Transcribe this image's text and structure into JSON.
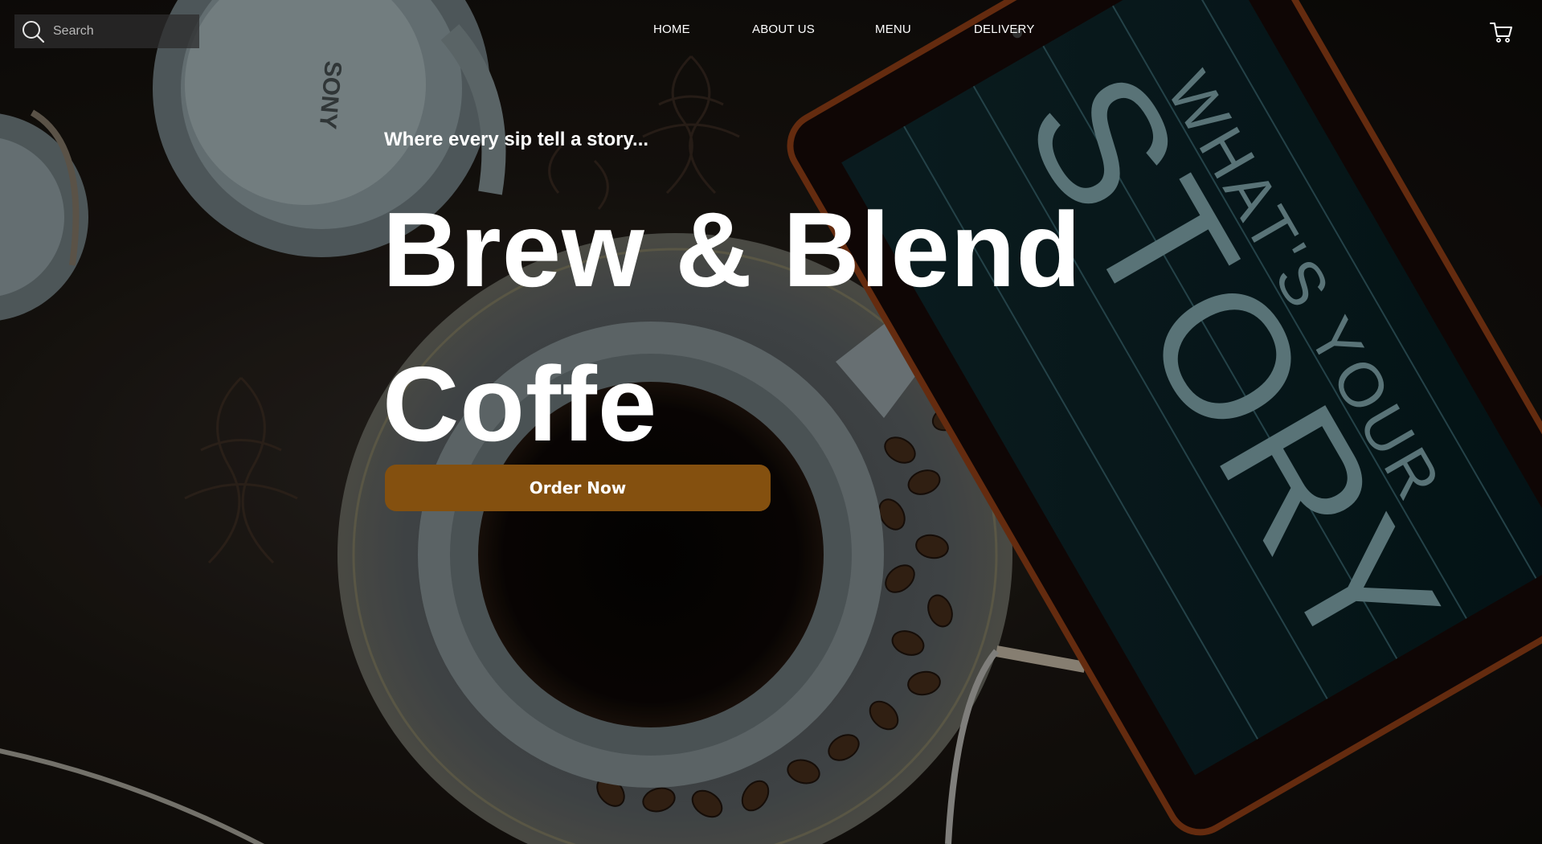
{
  "search": {
    "placeholder": "Search",
    "icon": "search-icon"
  },
  "nav": {
    "items": [
      {
        "label": "HOME"
      },
      {
        "label": "ABOUT US"
      },
      {
        "label": "MENU"
      },
      {
        "label": "DELIVERY"
      }
    ]
  },
  "cart": {
    "icon": "cart-icon"
  },
  "hero": {
    "tagline": "Where every sip tell a story...",
    "title": "Brew & Blend Coffe",
    "cta_label": "Order Now"
  },
  "background": {
    "headphones_brand": "SONY",
    "tablet_text_small": "WHAT'S YOUR",
    "tablet_text_large": "STORY"
  },
  "colors": {
    "accent": "#84500f",
    "text": "#ffffff",
    "background": "#17130f"
  }
}
